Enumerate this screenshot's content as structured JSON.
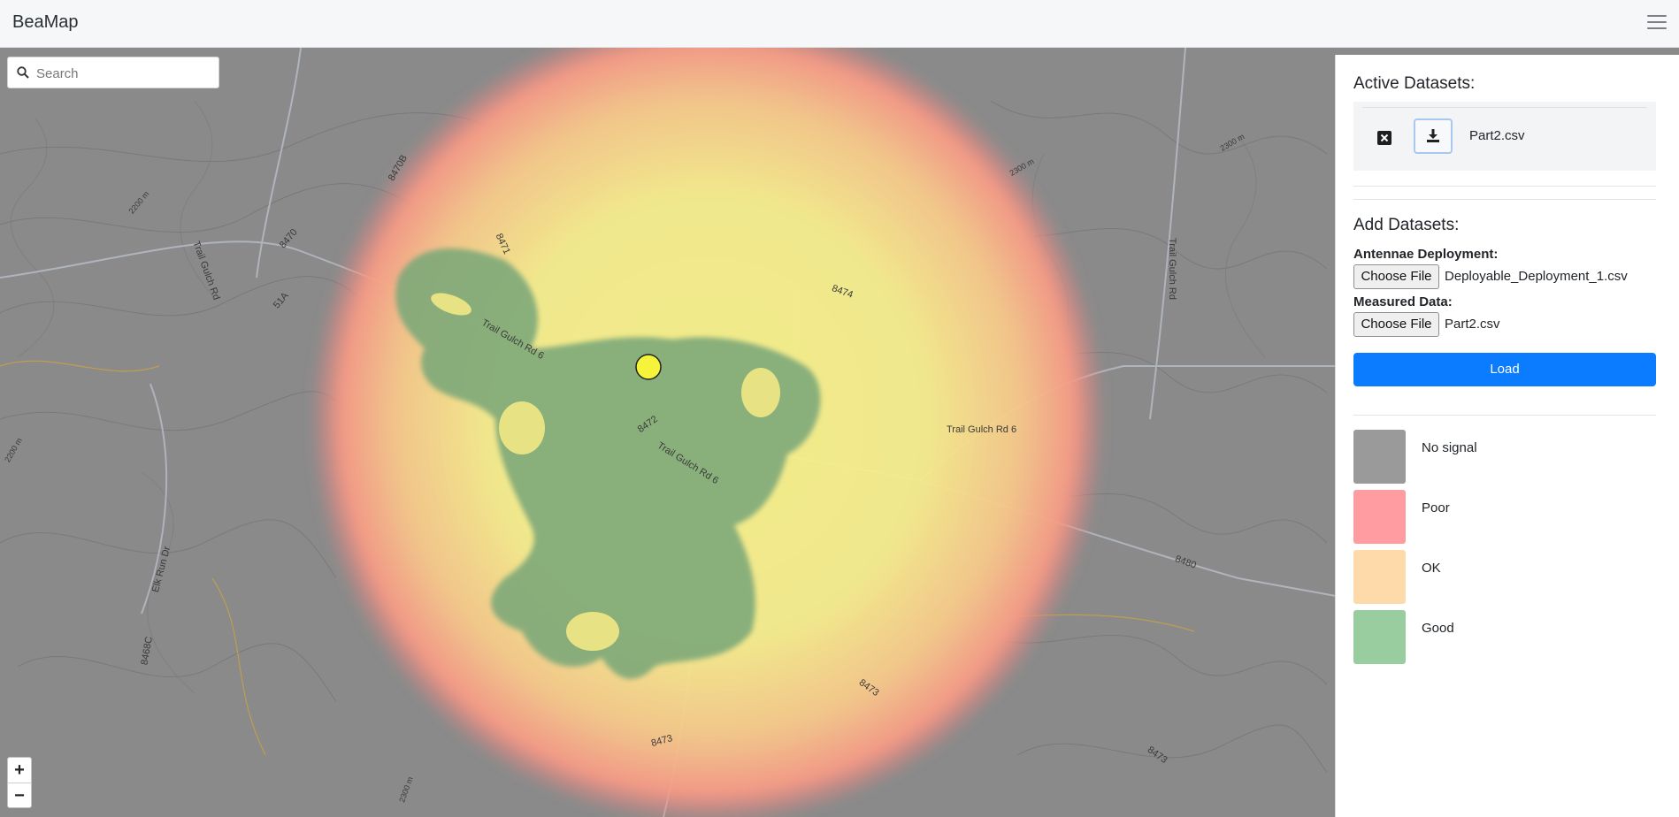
{
  "app": {
    "title": "BeaMap"
  },
  "search": {
    "placeholder": "Search"
  },
  "zoom": {
    "in_label": "+",
    "out_label": "−"
  },
  "map": {
    "road_labels": [
      "8470B",
      "8471",
      "8470",
      "51A",
      "Trail Gulch Rd",
      "Trail Gulch Rd 6",
      "8472",
      "Trail Gulch Rd 6",
      "8474",
      "Trail Gulch Rd 6",
      "Trail Gulch Rd",
      "Elk Run Dr",
      "8468C",
      "8480",
      "8473",
      "8473",
      "8473",
      "2300 m",
      "2300 m",
      "2200 m",
      "2200 m",
      "2300 m"
    ]
  },
  "panel": {
    "active_title": "Active Datasets:",
    "active_datasets": [
      {
        "name": "Part2.csv"
      }
    ],
    "add_title": "Add Datasets:",
    "antennae_label": "Antennae Deployment:",
    "antennae_button": "Choose File",
    "antennae_file": "Deployable_Deployment_1.csv",
    "measured_label": "Measured Data:",
    "measured_button": "Choose File",
    "measured_file": "Part2.csv",
    "load_label": "Load"
  },
  "legend": [
    {
      "label": "No signal",
      "color": "#9a9a9a"
    },
    {
      "label": "Poor",
      "color": "#ff9ca1"
    },
    {
      "label": "OK",
      "color": "#fedaaa"
    },
    {
      "label": "Good",
      "color": "#99cc9f"
    }
  ]
}
